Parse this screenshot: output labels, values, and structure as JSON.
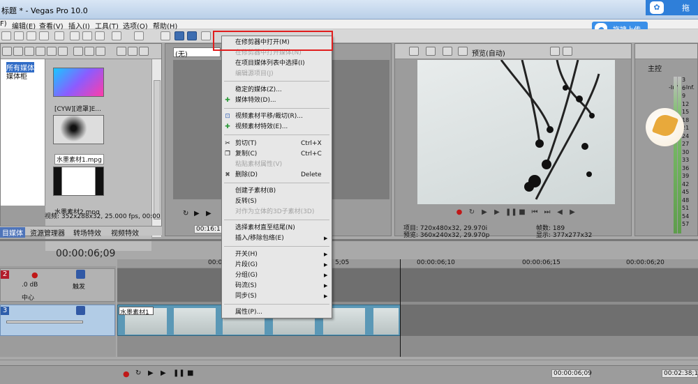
{
  "window": {
    "title": "标题 * - Vegas Pro 10.0"
  },
  "menubar": [
    "F)",
    "编辑(E)",
    "查看(V)",
    "插入(I)",
    "工具(T)",
    "选项(O)",
    "帮助(H)"
  ],
  "overlay": {
    "upload_label": "拖拽上传",
    "logo_text": "拖"
  },
  "explorer": {
    "tree": [
      "所有媒体",
      "媒体柜"
    ],
    "items": [
      {
        "label": "[CYW][遮罩]E..."
      },
      {
        "label": "水墨素材1.mpg"
      },
      {
        "label": "水墨素材2.mpg"
      }
    ],
    "media_info": "视频: 352x288x32, 25.000 fps, 00:00",
    "tabs": [
      "目媒体",
      "资源管理器",
      "转场特效",
      "视频特效"
    ]
  },
  "trimmer": {
    "dropdown": "(无)",
    "time": "00:16:1"
  },
  "preview": {
    "mode": "预览(自动)",
    "project_info": "项目: 720x480x32, 29.970i",
    "preview_info": "预览: 360x240x32, 29.970p",
    "frame_label": "帧数: 189",
    "display_label": "显示: 377x277x32"
  },
  "mixer": {
    "title": "主控",
    "inf_left": "-Inf.",
    "inf_right": "-Inf.",
    "ticks": [
      "3",
      "6",
      "9",
      "12",
      "15",
      "18",
      "21",
      "24",
      "27",
      "30",
      "33",
      "36",
      "39",
      "42",
      "45",
      "48",
      "51",
      "54",
      "57"
    ]
  },
  "timeline": {
    "timecode": "00:00:06;09",
    "ruler": [
      "00:00:00;00",
      "00:00:06;10",
      "00:00:06;15",
      "00:00:06;20"
    ],
    "ruler_partial": "5;05",
    "tracks": [
      {
        "number": "2",
        "db": ".0 dB",
        "pan": "中心",
        "mode": "触发"
      },
      {
        "number": "3",
        "clip": "水墨素材1"
      }
    ]
  },
  "transport": {
    "time": "00:00:06;09",
    "time2": "00:02:38;1"
  },
  "context_menu": {
    "items": [
      {
        "label": "在修剪器中打开(M)",
        "disabled": false
      },
      {
        "label": "在修剪器中打开媒体(N)",
        "disabled": true
      },
      {
        "label": "在项目媒体列表中选择(I)",
        "disabled": false
      },
      {
        "label": "编辑源项目(J)",
        "disabled": true
      },
      {
        "label": "稳定的媒体(Z)...",
        "disabled": false
      },
      {
        "label": "媒体特效(D)...",
        "disabled": false
      },
      {
        "label": "视频素材平移/裁切(R)...",
        "disabled": false
      },
      {
        "label": "视频素材特效(E)...",
        "disabled": false
      },
      {
        "label": "剪切(T)",
        "shortcut": "Ctrl+X",
        "disabled": false
      },
      {
        "label": "复制(C)",
        "shortcut": "Ctrl+C",
        "disabled": false
      },
      {
        "label": "粘贴素材属性(V)",
        "disabled": true
      },
      {
        "label": "删除(D)",
        "shortcut": "Delete",
        "disabled": false
      },
      {
        "label": "创建子素材(B)",
        "disabled": false
      },
      {
        "label": "反转(S)",
        "disabled": false
      },
      {
        "label": "对作为立体的3D子素材(3D)",
        "disabled": true
      },
      {
        "label": "选择素材直至结尾(N)",
        "disabled": false
      },
      {
        "label": "插入/移除包络(E)",
        "disabled": false
      },
      {
        "label": "开关(H)",
        "disabled": false
      },
      {
        "label": "片段(G)",
        "disabled": false
      },
      {
        "label": "分组(G)",
        "disabled": false
      },
      {
        "label": "码流(S)",
        "disabled": false
      },
      {
        "label": "同步(S)",
        "disabled": false
      },
      {
        "label": "属性(P)...",
        "disabled": false
      }
    ]
  },
  "colors": {
    "highlight": "#e11d1d",
    "upload_blue": "#3a8fe8",
    "clip_blue": "#5b98b6"
  }
}
